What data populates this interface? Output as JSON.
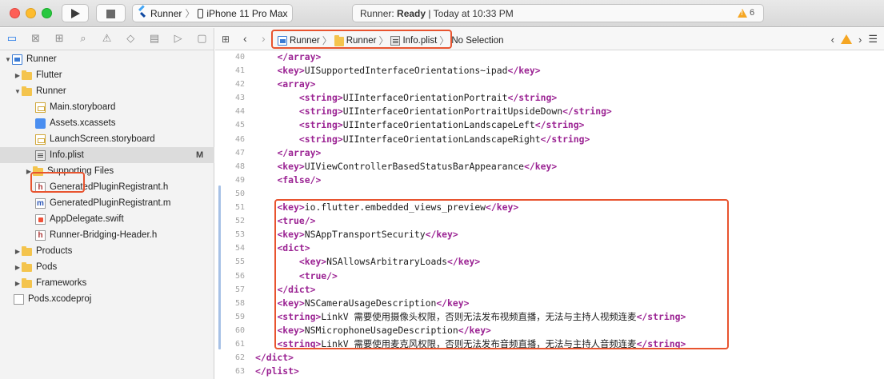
{
  "toolbar": {
    "scheme_name": "Runner",
    "device_name": "iPhone 11 Pro Max",
    "status_app": "Runner:",
    "status_state": "Ready",
    "status_time": "Today at 10:33 PM",
    "warning_count": "6"
  },
  "navigator": {
    "items": [
      {
        "label": "Runner"
      },
      {
        "label": "Flutter"
      },
      {
        "label": "Runner"
      },
      {
        "label": "Main.storyboard"
      },
      {
        "label": "Assets.xcassets"
      },
      {
        "label": "LaunchScreen.storyboard"
      },
      {
        "label": "Info.plist",
        "badge": "M"
      },
      {
        "label": "Supporting Files"
      },
      {
        "label": "GeneratedPluginRegistrant.h"
      },
      {
        "label": "GeneratedPluginRegistrant.m"
      },
      {
        "label": "AppDelegate.swift"
      },
      {
        "label": "Runner-Bridging-Header.h"
      },
      {
        "label": "Products"
      },
      {
        "label": "Pods"
      },
      {
        "label": "Frameworks"
      },
      {
        "label": "Pods.xcodeproj"
      }
    ]
  },
  "jumpbar": {
    "crumbs": [
      "Runner",
      "Runner",
      "Info.plist",
      "No Selection"
    ]
  },
  "code": {
    "lines": [
      {
        "n": "40",
        "pre": "    ",
        "parts": [
          {
            "k": "tg",
            "t": "</array>"
          }
        ]
      },
      {
        "n": "41",
        "pre": "    ",
        "parts": [
          {
            "k": "tg",
            "t": "<key>"
          },
          {
            "k": "tx",
            "t": "UISupportedInterfaceOrientations~ipad"
          },
          {
            "k": "tg",
            "t": "</key>"
          }
        ]
      },
      {
        "n": "42",
        "pre": "    ",
        "parts": [
          {
            "k": "tg",
            "t": "<array>"
          }
        ]
      },
      {
        "n": "43",
        "pre": "        ",
        "parts": [
          {
            "k": "tg",
            "t": "<string>"
          },
          {
            "k": "tx",
            "t": "UIInterfaceOrientationPortrait"
          },
          {
            "k": "tg",
            "t": "</string>"
          }
        ]
      },
      {
        "n": "44",
        "pre": "        ",
        "parts": [
          {
            "k": "tg",
            "t": "<string>"
          },
          {
            "k": "tx",
            "t": "UIInterfaceOrientationPortraitUpsideDown"
          },
          {
            "k": "tg",
            "t": "</string>"
          }
        ]
      },
      {
        "n": "45",
        "pre": "        ",
        "parts": [
          {
            "k": "tg",
            "t": "<string>"
          },
          {
            "k": "tx",
            "t": "UIInterfaceOrientationLandscapeLeft"
          },
          {
            "k": "tg",
            "t": "</string>"
          }
        ]
      },
      {
        "n": "46",
        "pre": "        ",
        "parts": [
          {
            "k": "tg",
            "t": "<string>"
          },
          {
            "k": "tx",
            "t": "UIInterfaceOrientationLandscapeRight"
          },
          {
            "k": "tg",
            "t": "</string>"
          }
        ]
      },
      {
        "n": "47",
        "pre": "    ",
        "parts": [
          {
            "k": "tg",
            "t": "</array>"
          }
        ]
      },
      {
        "n": "48",
        "pre": "    ",
        "parts": [
          {
            "k": "tg",
            "t": "<key>"
          },
          {
            "k": "tx",
            "t": "UIViewControllerBasedStatusBarAppearance"
          },
          {
            "k": "tg",
            "t": "</key>"
          }
        ]
      },
      {
        "n": "49",
        "pre": "    ",
        "parts": [
          {
            "k": "tg",
            "t": "<false/>"
          }
        ]
      },
      {
        "n": "50",
        "pre": "",
        "parts": []
      },
      {
        "n": "51",
        "pre": "    ",
        "parts": [
          {
            "k": "tg",
            "t": "<key>"
          },
          {
            "k": "tx",
            "t": "io.flutter.embedded_views_preview"
          },
          {
            "k": "tg",
            "t": "</key>"
          }
        ]
      },
      {
        "n": "52",
        "pre": "    ",
        "parts": [
          {
            "k": "tg",
            "t": "<true/>"
          }
        ]
      },
      {
        "n": "53",
        "pre": "    ",
        "parts": [
          {
            "k": "tg",
            "t": "<key>"
          },
          {
            "k": "tx",
            "t": "NSAppTransportSecurity"
          },
          {
            "k": "tg",
            "t": "</key>"
          }
        ]
      },
      {
        "n": "54",
        "pre": "    ",
        "parts": [
          {
            "k": "tg",
            "t": "<dict>"
          }
        ]
      },
      {
        "n": "55",
        "pre": "        ",
        "parts": [
          {
            "k": "tg",
            "t": "<key>"
          },
          {
            "k": "tx",
            "t": "NSAllowsArbitraryLoads"
          },
          {
            "k": "tg",
            "t": "</key>"
          }
        ]
      },
      {
        "n": "56",
        "pre": "        ",
        "parts": [
          {
            "k": "tg",
            "t": "<true/>"
          }
        ]
      },
      {
        "n": "57",
        "pre": "    ",
        "parts": [
          {
            "k": "tg",
            "t": "</dict>"
          }
        ]
      },
      {
        "n": "58",
        "pre": "    ",
        "parts": [
          {
            "k": "tg",
            "t": "<key>"
          },
          {
            "k": "tx",
            "t": "NSCameraUsageDescription"
          },
          {
            "k": "tg",
            "t": "</key>"
          }
        ]
      },
      {
        "n": "59",
        "pre": "    ",
        "parts": [
          {
            "k": "tg",
            "t": "<string>"
          },
          {
            "k": "tx",
            "t": "LinkV 需要使用摄像头权限，否则无法发布视频直播，无法与主持人视频连麦"
          },
          {
            "k": "tg",
            "t": "</string>"
          }
        ]
      },
      {
        "n": "60",
        "pre": "    ",
        "parts": [
          {
            "k": "tg",
            "t": "<key>"
          },
          {
            "k": "tx",
            "t": "NSMicrophoneUsageDescription"
          },
          {
            "k": "tg",
            "t": "</key>"
          }
        ]
      },
      {
        "n": "61",
        "pre": "    ",
        "parts": [
          {
            "k": "tg",
            "t": "<string>"
          },
          {
            "k": "tx",
            "t": "LinkV 需要使用麦克风权限，否则无法发布音频直播，无法与主持人音频连麦"
          },
          {
            "k": "tg",
            "t": "</string>"
          }
        ]
      },
      {
        "n": "62",
        "pre": "",
        "parts": [
          {
            "k": "tg",
            "t": "</dict>"
          }
        ]
      },
      {
        "n": "63",
        "pre": "",
        "parts": [
          {
            "k": "tg",
            "t": "</plist>"
          }
        ]
      }
    ]
  },
  "colors": {
    "highlight": "#e8542f",
    "tag": "#9b2393"
  }
}
